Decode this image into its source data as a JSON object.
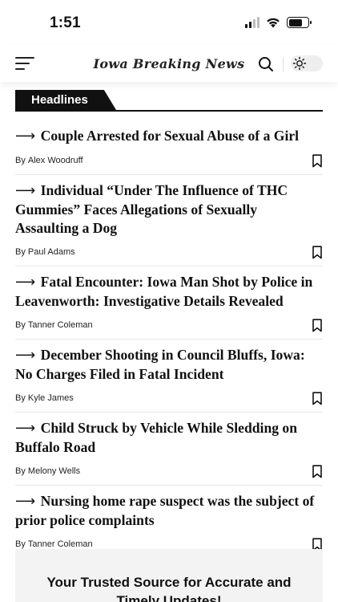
{
  "status": {
    "time": "1:51"
  },
  "header": {
    "site_name": "Iowa Breaking News"
  },
  "section": {
    "title": "Headlines"
  },
  "articles": [
    {
      "arrow": "⟶",
      "title": "Couple Arrested for Sexual Abuse of a Girl",
      "by": "By",
      "author": "Alex Woodruff"
    },
    {
      "arrow": "⟶",
      "title": "Individual “Under The Influence of THC Gummies” Faces Allegations of Sexually Assaulting a Dog",
      "by": "By",
      "author": "Paul Adams"
    },
    {
      "arrow": "⟶",
      "title": "Fatal Encounter: Iowa Man Shot by Police in Leavenworth: Investigative Details Revealed",
      "by": "By",
      "author": "Tanner Coleman"
    },
    {
      "arrow": "⟶",
      "title": "December Shooting in Council Bluffs, Iowa: No Charges Filed in Fatal Incident",
      "by": "By",
      "author": "Kyle James"
    },
    {
      "arrow": "⟶",
      "title": "Child Struck by Vehicle While Sledding on Buffalo Road",
      "by": "By",
      "author": "Melony Wells"
    },
    {
      "arrow": "⟶",
      "title": "Nursing home rape suspect was the subject of prior police complaints",
      "by": "By",
      "author": "Tanner Coleman"
    }
  ],
  "promo": {
    "text": "Your Trusted Source for Accurate and Timely Updates!"
  },
  "icons": {
    "menu": "hamburger-icon",
    "search": "search-icon",
    "theme": "sun-icon",
    "bookmark": "bookmark-icon",
    "wifi": "wifi-icon",
    "battery": "battery-icon",
    "signal": "signal-icon"
  },
  "colors": {
    "accent": "#111111",
    "background": "#ffffff",
    "promo_bg": "#f3f3f3"
  },
  "battery_level": 0.7
}
